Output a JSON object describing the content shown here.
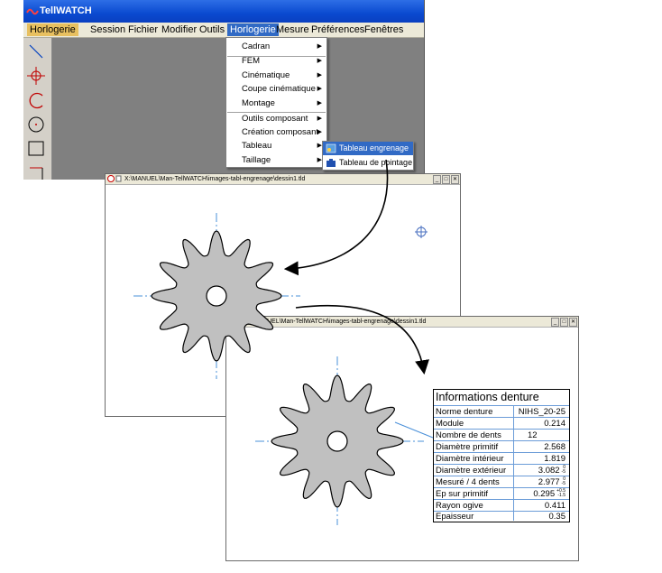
{
  "app": {
    "title": "TellWATCH",
    "menu": [
      "Horlogerie",
      "Session",
      "Fichier",
      "Modifier",
      "Outils",
      "Horlogerie",
      "Mesure",
      "Préférences",
      "Fenêtres"
    ]
  },
  "dropdown": {
    "items": [
      "Cadran",
      "FEM",
      "Cinématique",
      "Coupe cinématique",
      "Montage",
      "Outils composant",
      "Création composant",
      "Tableau",
      "Taillage"
    ]
  },
  "submenu": {
    "items": [
      "Tableau engrenage",
      "Tableau de pointage"
    ]
  },
  "window1": {
    "title": "X:\\MANUEL\\Man-TellWATCH\\images-tabl-engrenage\\dessin1.tld"
  },
  "window2": {
    "title": "X:\\MANUEL\\Man-TellWATCH\\images-tabl-engrenage\\dessin1.tld"
  },
  "info_table": {
    "title": "Informations  denture",
    "rows": [
      {
        "label": "Norme denture",
        "value": "NIHS_20-25"
      },
      {
        "label": "Module",
        "value": "0.214"
      },
      {
        "label": "Nombre de dents",
        "value": "12"
      },
      {
        "label": "Diamètre primitif",
        "value": "2.568"
      },
      {
        "label": "Diamètre intérieur",
        "value": "1.819"
      },
      {
        "label": "Diamètre extérieur",
        "value": "3.082",
        "tol_top": "0",
        "tol_bottom": "-5"
      },
      {
        "label": "Mesuré / 4 dents",
        "value": "2.977",
        "tol_top": "0",
        "tol_bottom": "-5"
      },
      {
        "label": "Ep sur primitif",
        "value": "0.295",
        "tol_top": "+0.5",
        "tol_bottom": "-1.5"
      },
      {
        "label": "Rayon ogive",
        "value": "0.411"
      },
      {
        "label": "Epaisseur",
        "value": "0.35"
      }
    ]
  },
  "colors": {
    "titlebar": "#0a4ad0",
    "menu_highlight": "#316ac5",
    "gear_fill": "#c0c0c0",
    "centerline": "#4a90d9",
    "table_grid": "#6b9cd8"
  },
  "icons": [
    "line-tool-icon",
    "crosshair-tool-icon",
    "arc-tool-icon",
    "circle-tool-icon",
    "rectangle-tool-icon"
  ]
}
